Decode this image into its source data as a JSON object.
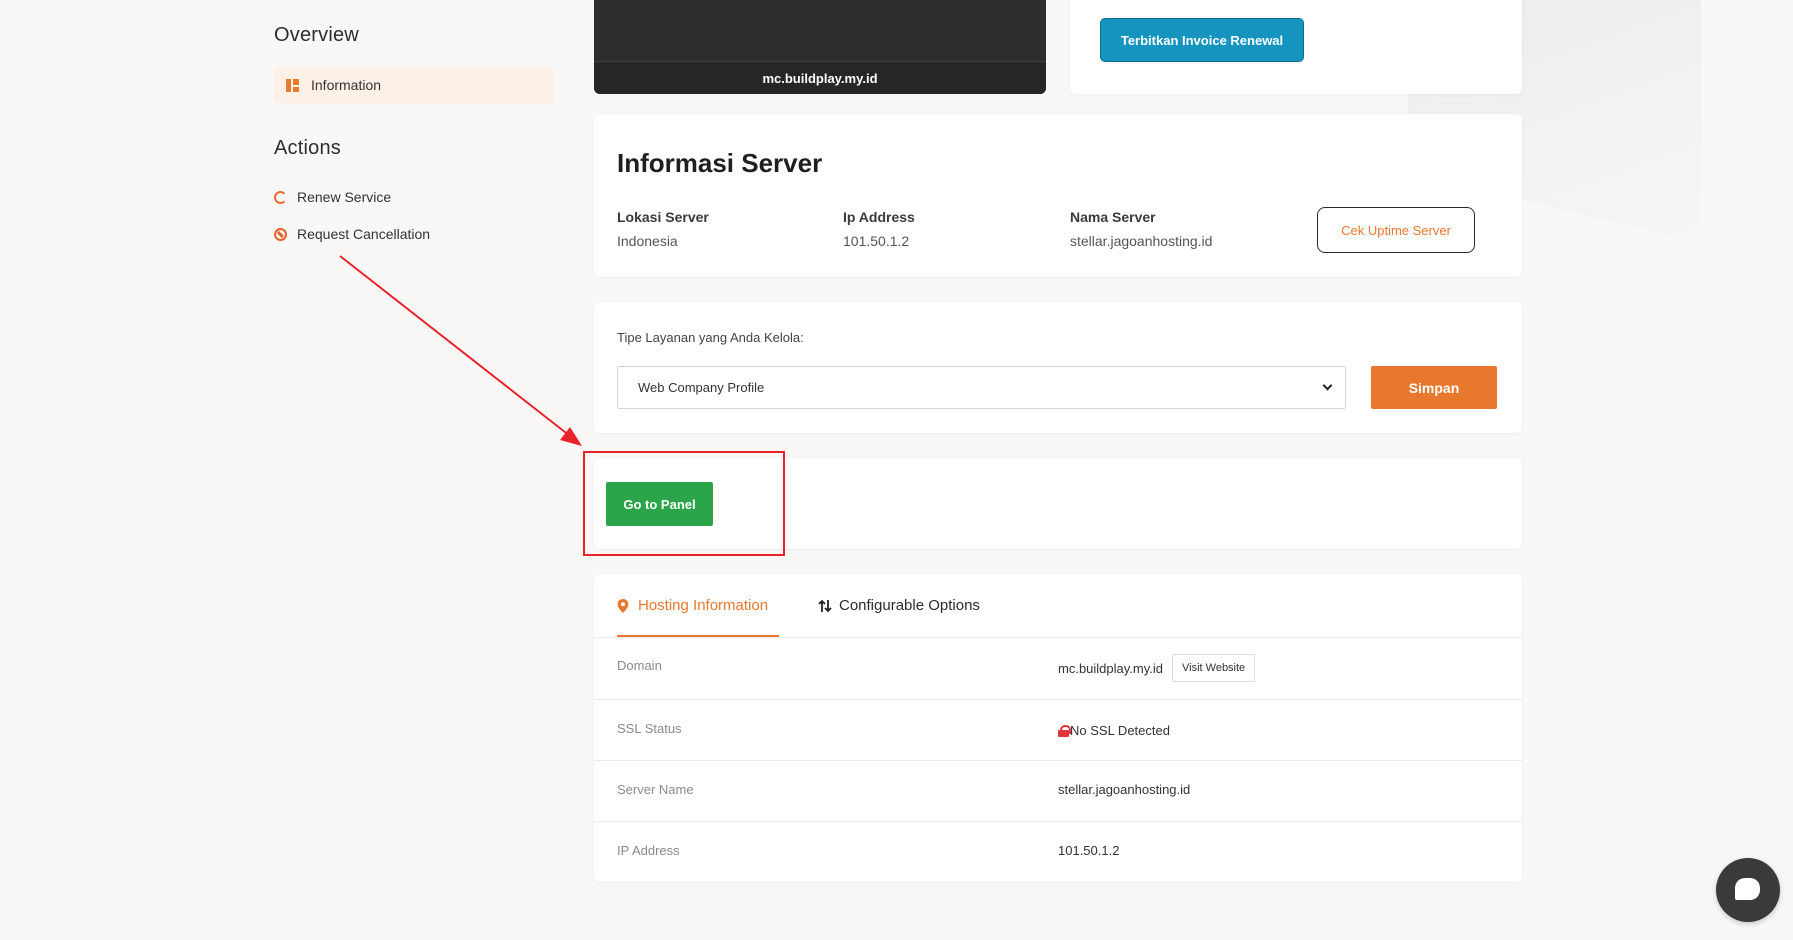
{
  "sidebar": {
    "overview_title": "Overview",
    "information_label": "Information",
    "actions_title": "Actions",
    "renew_label": "Renew Service",
    "cancel_label": "Request Cancellation"
  },
  "server_preview": {
    "domain": "mc.buildplay.my.id"
  },
  "invoice": {
    "button_label": "Terbitkan Invoice Renewal"
  },
  "server_info": {
    "title": "Informasi Server",
    "location_label": "Lokasi Server",
    "location_value": "Indonesia",
    "ip_label": "Ip Address",
    "ip_value": "101.50.1.2",
    "name_label": "Nama Server",
    "name_value": "stellar.jagoanhosting.id",
    "uptime_button": "Cek Uptime Server"
  },
  "service_type": {
    "label": "Tipe Layanan yang Anda Kelola:",
    "selected": "Web Company Profile",
    "save_button": "Simpan"
  },
  "panel": {
    "button_label": "Go to Panel"
  },
  "tabs": [
    {
      "label": "Hosting Information",
      "icon": "map-pin-icon"
    },
    {
      "label": "Configurable Options",
      "icon": "sort-arrows-icon"
    }
  ],
  "hosting_rows": [
    {
      "label": "Domain",
      "value": "mc.buildplay.my.id",
      "action": "Visit Website"
    },
    {
      "label": "SSL Status",
      "value": "No SSL Detected"
    },
    {
      "label": "Server Name",
      "value": "stellar.jagoanhosting.id"
    },
    {
      "label": "IP Address",
      "value": "101.50.1.2"
    }
  ],
  "colors": {
    "accent": "#e8782e",
    "invoice_button": "#1494be",
    "panel_button": "#2ba44a",
    "annotation_red": "#e8232a"
  }
}
